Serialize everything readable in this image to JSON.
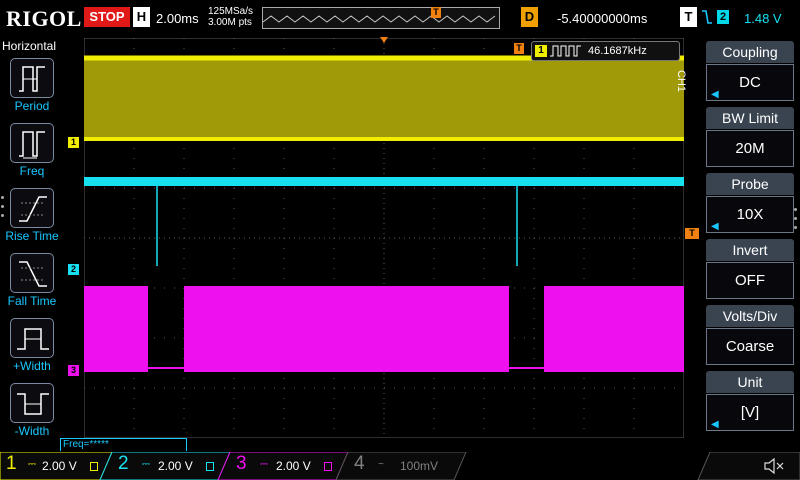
{
  "topbar": {
    "brand": "RIGOL",
    "run_state": "STOP",
    "horizontal_badge": "H",
    "timebase": "2.00ms",
    "sample_rate": "125MSa/s",
    "memory_depth": "3.00M pts",
    "delay_badge": "D",
    "delay": "-5.40000000ms",
    "trigger_badge": "T",
    "trigger_source": "2",
    "trigger_level": "1.48 V",
    "trigger_marker": "T"
  },
  "left_menu": {
    "title": "Horizontal",
    "items": [
      {
        "label": "Period",
        "icon": "period-icon"
      },
      {
        "label": "Freq",
        "icon": "freq-icon"
      },
      {
        "label": "Rise Time",
        "icon": "rise-time-icon"
      },
      {
        "label": "Fall Time",
        "icon": "fall-time-icon"
      },
      {
        "label": "+Width",
        "icon": "positive-width-icon"
      },
      {
        "label": "-Width",
        "icon": "negative-width-icon"
      }
    ]
  },
  "screen": {
    "measurement_channel": "1",
    "measurement_value": "46.1687kHz",
    "trigger_marker": "T",
    "channel_markers": {
      "ch1": "1",
      "ch2": "2",
      "ch3": "3"
    },
    "colors": {
      "ch1": "#f0ee00",
      "ch1_fill": "#a09a08",
      "ch2": "#18e0f0",
      "ch3": "#ee10ee",
      "grid": "#5a5a5a",
      "trigger": "#f08010"
    }
  },
  "right_menu": {
    "channel": "CH1",
    "groups": [
      {
        "title": "Coupling",
        "value": "DC",
        "has_arrow": true
      },
      {
        "title": "BW Limit",
        "value": "20M",
        "has_arrow": false
      },
      {
        "title": "Probe",
        "value": "10X",
        "has_arrow": true
      },
      {
        "title": "Invert",
        "value": "OFF",
        "has_arrow": false
      },
      {
        "title": "Volts/Div",
        "value": "Coarse",
        "has_arrow": false
      },
      {
        "title": "Unit",
        "value": "[V]",
        "has_arrow": true
      }
    ]
  },
  "bottombar": {
    "freq_counter": "Freq=*****",
    "channels": [
      {
        "num": "1",
        "scale": "2.00 V",
        "color": "#f0ee00",
        "active": true
      },
      {
        "num": "2",
        "scale": "2.00 V",
        "color": "#18e0f0",
        "active": true
      },
      {
        "num": "3",
        "scale": "2.00 V",
        "color": "#ee10ee",
        "active": true
      },
      {
        "num": "4",
        "scale": "100mV",
        "color": "#808080",
        "active": false
      }
    ]
  }
}
